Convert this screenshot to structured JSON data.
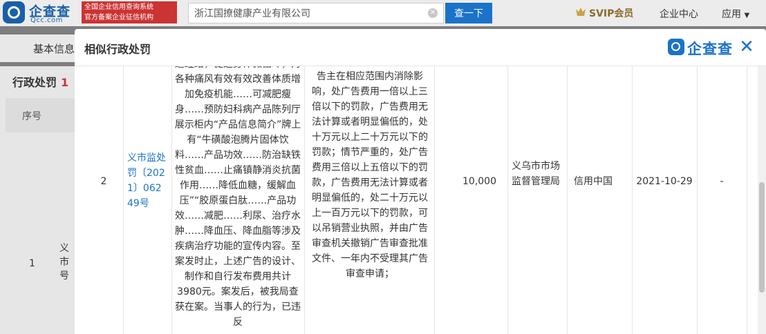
{
  "header": {
    "logo_name": "企查查",
    "logo_domain": "Qcc.com",
    "badge_line1": "全国企业信用查询系统",
    "badge_line2": "官方备案企业征信机构",
    "search_value": "浙江国撩健康产业有限公司",
    "search_button": "查一下",
    "svip_label": "SVIP会员",
    "enterprise_center": "企业中心",
    "apps_label": "应用"
  },
  "background": {
    "tab_label": "基本信息",
    "section_title": "行政处罚",
    "section_count": "1",
    "col_index": "序号",
    "row_index": "1",
    "row_name_fragment": "义市号"
  },
  "modal": {
    "title": "相似行政处罚",
    "logo_name": "企查查",
    "close_icon": "close-icon",
    "row": {
      "index": "2",
      "doc_number": "义市监处罚〔2021〕06249号",
      "facts": "通经络，促进身体微循环，对各种痛风有效有效改善体质增加免疫机能……可减肥瘦身……预防妇科病产品陈列厅展示柜内“产品信息简介”牌上有“牛磺酸泡腾片固体饮料……产品功效……防治缺铁性贫血……止痛镇静消炎抗菌作用……降低血糖，缓解血压”“胶原蛋白肽……产品功效……减肥……利尿、治疗水肿……降血压、降血脂等涉及疾病治疗功能的宣传内容。至案发时止，上述广告的设计、制作和自行发布费用共计3980元。案发后，被我局查获在案。当事人的行为，已违反",
      "penalty_basis": "责令停止发布广告，责令广告主在相应范围内消除影响，处广告费用一倍以上三倍以下的罚款，广告费用无法计算或者明显偏低的，处十万元以上二十万元以下的罚款；情节严重的，处广告费用三倍以上五倍以下的罚款，广告费用无法计算或者明显偏低的，处二十万元以上一百万元以下的罚款，可以吊销营业执照，并由广告审查机关撤销广告审查批准文件、一年内不受理其广告审查申请；",
      "amount": "10,000",
      "authority": "义乌市市场监督管理局",
      "source": "信用中国",
      "date": "2021-10-29",
      "remark": "-"
    }
  }
}
